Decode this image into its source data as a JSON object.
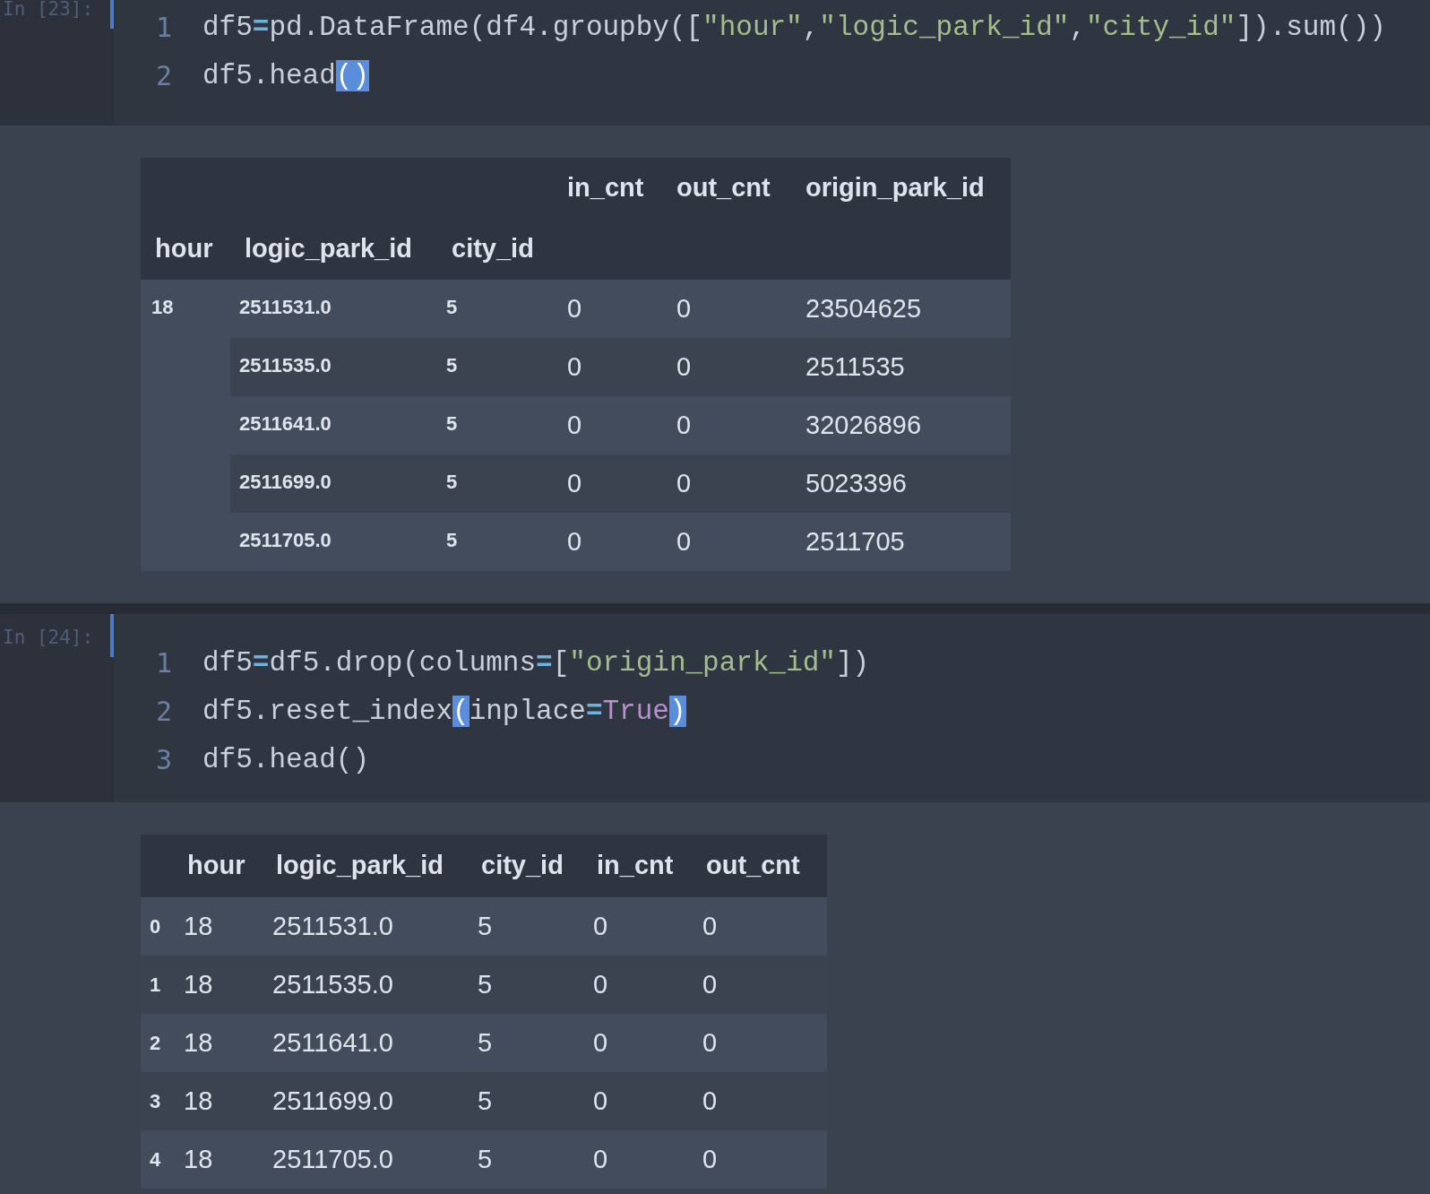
{
  "cells": [
    {
      "prompt": "In [23]:",
      "active": true,
      "lines": [
        [
          {
            "text": "df5",
            "kind": "plain"
          },
          {
            "text": "=",
            "kind": "operator"
          },
          {
            "text": "pd.DataFrame(df4.groupby([",
            "kind": "plain"
          },
          {
            "text": "\"hour\"",
            "kind": "string"
          },
          {
            "text": ",",
            "kind": "plain"
          },
          {
            "text": "\"logic_park_id\"",
            "kind": "string"
          },
          {
            "text": ",",
            "kind": "plain"
          },
          {
            "text": "\"city_id\"",
            "kind": "string"
          },
          {
            "text": "]).sum())",
            "kind": "plain"
          }
        ],
        [
          {
            "text": "df5.head",
            "kind": "plain"
          },
          {
            "text": "()",
            "kind": "matched-bracket"
          }
        ]
      ],
      "line_numbers": [
        "1",
        "2"
      ],
      "output": {
        "kind": "multiindex",
        "columns": [
          "in_cnt",
          "out_cnt",
          "origin_park_id"
        ],
        "index_names": [
          "hour",
          "logic_park_id",
          "city_id"
        ],
        "groups": [
          {
            "hour": "18",
            "rows": [
              {
                "index": [
                  "2511531.0",
                  "5"
                ],
                "values": [
                  "0",
                  "0",
                  "23504625"
                ]
              },
              {
                "index": [
                  "2511535.0",
                  "5"
                ],
                "values": [
                  "0",
                  "0",
                  "2511535"
                ]
              },
              {
                "index": [
                  "2511641.0",
                  "5"
                ],
                "values": [
                  "0",
                  "0",
                  "32026896"
                ]
              },
              {
                "index": [
                  "2511699.0",
                  "5"
                ],
                "values": [
                  "0",
                  "0",
                  "5023396"
                ]
              },
              {
                "index": [
                  "2511705.0",
                  "5"
                ],
                "values": [
                  "0",
                  "0",
                  "2511705"
                ]
              }
            ]
          }
        ]
      }
    },
    {
      "prompt": "In [24]:",
      "active": true,
      "lines": [
        [
          {
            "text": "df5",
            "kind": "plain"
          },
          {
            "text": "=",
            "kind": "operator"
          },
          {
            "text": "df5.drop(columns",
            "kind": "plain"
          },
          {
            "text": "=",
            "kind": "operator"
          },
          {
            "text": "[",
            "kind": "plain"
          },
          {
            "text": "\"origin_park_id\"",
            "kind": "string"
          },
          {
            "text": "])",
            "kind": "plain"
          }
        ],
        [
          {
            "text": "df5.reset_index",
            "kind": "plain"
          },
          {
            "text": "(",
            "kind": "matched-bracket"
          },
          {
            "text": "inplace",
            "kind": "plain"
          },
          {
            "text": "=",
            "kind": "operator"
          },
          {
            "text": "True",
            "kind": "keyword"
          },
          {
            "text": ")",
            "kind": "matched-bracket"
          }
        ],
        [
          {
            "text": "df5.head()",
            "kind": "plain"
          }
        ]
      ],
      "line_numbers": [
        "1",
        "2",
        "3"
      ],
      "output": {
        "kind": "flat",
        "columns": [
          "hour",
          "logic_park_id",
          "city_id",
          "in_cnt",
          "out_cnt"
        ],
        "rows": [
          {
            "index": "0",
            "values": [
              "18",
              "2511531.0",
              "5",
              "0",
              "0"
            ]
          },
          {
            "index": "1",
            "values": [
              "18",
              "2511535.0",
              "5",
              "0",
              "0"
            ]
          },
          {
            "index": "2",
            "values": [
              "18",
              "2511641.0",
              "5",
              "0",
              "0"
            ]
          },
          {
            "index": "3",
            "values": [
              "18",
              "2511699.0",
              "5",
              "0",
              "0"
            ]
          },
          {
            "index": "4",
            "values": [
              "18",
              "2511705.0",
              "5",
              "0",
              "0"
            ]
          }
        ]
      }
    }
  ]
}
